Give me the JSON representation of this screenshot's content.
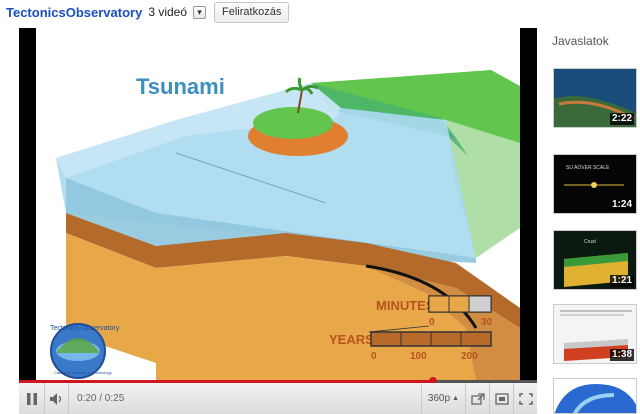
{
  "channel": {
    "name": "TectonicsObservatory",
    "video_count": "3 videó",
    "subscribe_label": "Feliratkozás"
  },
  "video": {
    "title_overlay": "Tsunami",
    "legend_minutes_label": "MINUTES",
    "legend_minutes_ticks": [
      "0",
      "30"
    ],
    "legend_years_label": "YEARS",
    "legend_years_ticks": [
      "0",
      "100",
      "200"
    ],
    "logo_text": "Tectonics Observatory",
    "logo_subtext": "California Institute of Technology"
  },
  "player": {
    "current_time": "0:20",
    "duration": "0:25",
    "time_display": "0:20 / 0:25",
    "progress_fraction": 0.8,
    "quality": "360p"
  },
  "sidebar": {
    "title": "Javaslatok",
    "items": [
      {
        "duration": "2:22"
      },
      {
        "duration": "1:24"
      },
      {
        "duration": "1:21"
      },
      {
        "duration": "1:38"
      },
      {
        "duration": ""
      }
    ]
  },
  "colors": {
    "channel_link": "#1b4fbf",
    "progress": "#cc181e",
    "water": "#7fc8e8",
    "land_green": "#5cc24a",
    "crust_orange": "#e0a640",
    "mantle_brown": "#a8642e"
  },
  "icons": {
    "play": "pause-icon",
    "volume": "speaker-icon",
    "popout": "popout-icon",
    "expand": "expand-icon",
    "fullscreen": "fullscreen-icon"
  }
}
